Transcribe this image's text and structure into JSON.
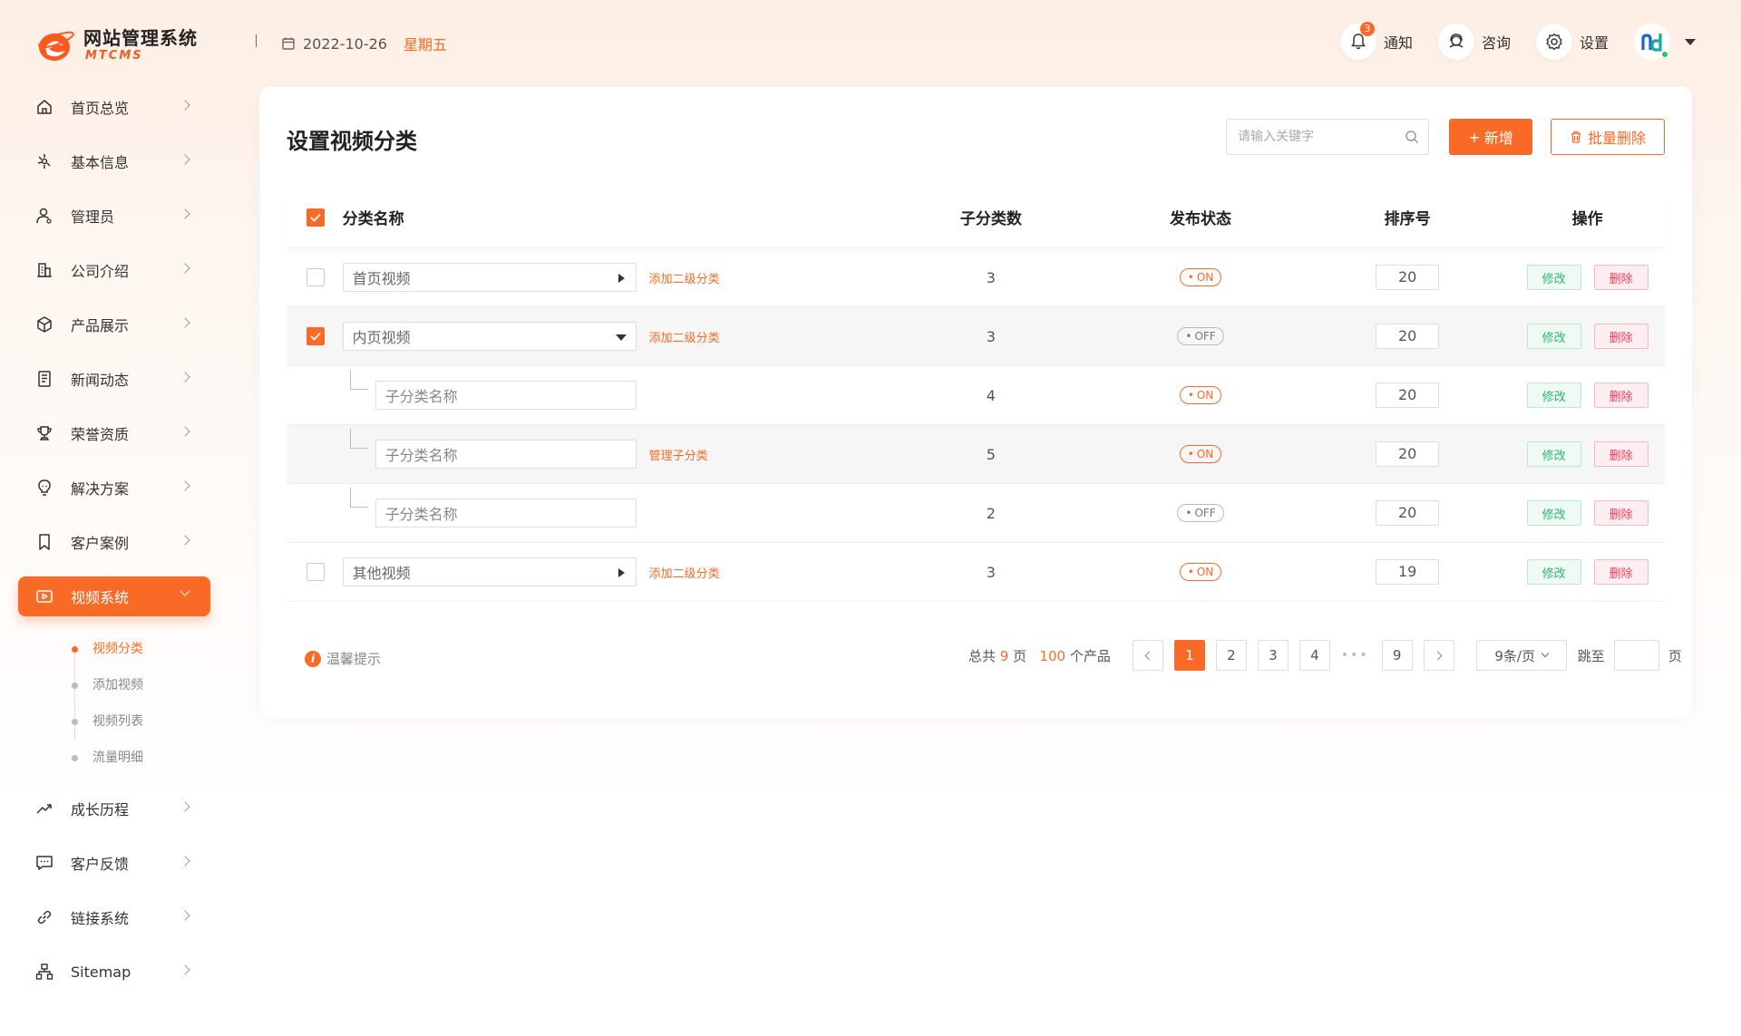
{
  "app": {
    "title": "网站管理系统",
    "subtitle": "MTCMS",
    "brand_color": "#fa6a27"
  },
  "header": {
    "date": "2022-10-26",
    "weekday": "星期五",
    "notify_label": "通知",
    "notify_count": "3",
    "consult_label": "咨询",
    "settings_label": "设置"
  },
  "sidebar": {
    "items": [
      {
        "label": "首页总览",
        "icon": "home-icon"
      },
      {
        "label": "基本信息",
        "icon": "info-icon"
      },
      {
        "label": "管理员",
        "icon": "user-icon"
      },
      {
        "label": "公司介绍",
        "icon": "building-icon"
      },
      {
        "label": "产品展示",
        "icon": "cube-icon"
      },
      {
        "label": "新闻动态",
        "icon": "news-icon"
      },
      {
        "label": "荣誉资质",
        "icon": "trophy-icon"
      },
      {
        "label": "解决方案",
        "icon": "bulb-icon"
      },
      {
        "label": "客户案例",
        "icon": "bookmark-icon"
      },
      {
        "label": "视频系统",
        "icon": "video-icon"
      },
      {
        "label": "成长历程",
        "icon": "trend-icon"
      },
      {
        "label": "客户反馈",
        "icon": "chat-icon"
      },
      {
        "label": "链接系统",
        "icon": "link-icon"
      },
      {
        "label": "Sitemap",
        "icon": "sitemap-icon"
      }
    ],
    "subitems": [
      {
        "label": "视频分类"
      },
      {
        "label": "添加视频"
      },
      {
        "label": "视频列表"
      },
      {
        "label": "流量明细"
      }
    ]
  },
  "main": {
    "title": "设置视频分类",
    "search_placeholder": "请输入关键字",
    "add_label": "新增",
    "batch_delete_label": "批量删除",
    "columns": [
      "分类名称",
      "子分类数",
      "发布状态",
      "排序号",
      "操作"
    ],
    "rows": [
      {
        "name": "首页视频",
        "link": "添加二级分类",
        "sub_count": "3",
        "status": "ON",
        "sort": "20",
        "edit": "修改",
        "delete": "删除"
      },
      {
        "name": "内页视频",
        "link": "添加二级分类",
        "sub_count": "3",
        "status": "OFF",
        "sort": "20",
        "edit": "修改",
        "delete": "删除"
      },
      {
        "name": "子分类名称",
        "link": "",
        "sub_count": "4",
        "status": "ON",
        "sort": "20",
        "edit": "修改",
        "delete": "删除"
      },
      {
        "name": "子分类名称",
        "link": "管理子分类",
        "sub_count": "5",
        "status": "ON",
        "sort": "20",
        "edit": "修改",
        "delete": "删除"
      },
      {
        "name": "子分类名称",
        "link": "",
        "sub_count": "2",
        "status": "OFF",
        "sort": "20",
        "edit": "修改",
        "delete": "删除"
      },
      {
        "name": "其他视频",
        "link": "添加二级分类",
        "sub_count": "3",
        "status": "ON",
        "sort": "19",
        "edit": "修改",
        "delete": "删除"
      }
    ]
  },
  "footer": {
    "tip": "温馨提示",
    "total_prefix": "总共",
    "total_pages": "9",
    "pages_unit": "页",
    "total_items": "100",
    "items_unit": "个产品",
    "pages": [
      "1",
      "2",
      "3",
      "4",
      "9"
    ],
    "current_page": "1",
    "per_page": "9条/页",
    "jump_label": "跳至",
    "jump_unit": "页"
  }
}
